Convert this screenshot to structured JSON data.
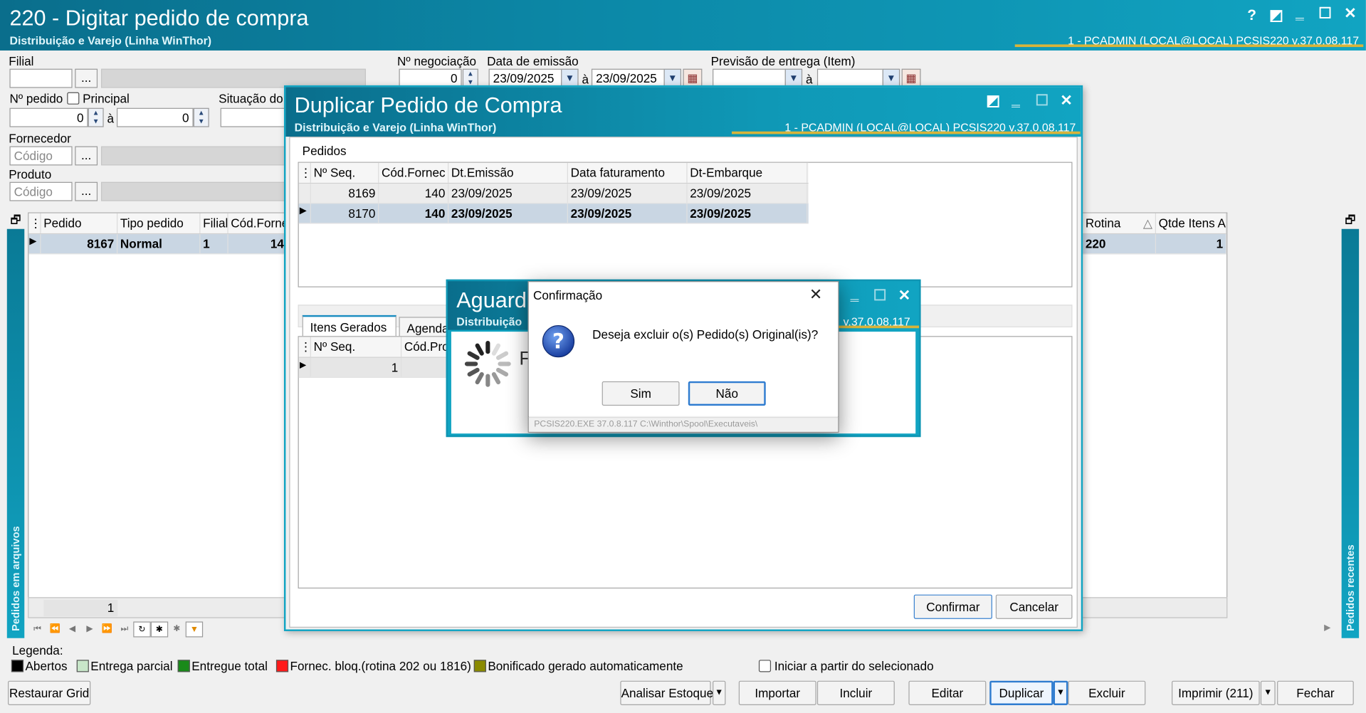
{
  "main": {
    "title": "220 - Digitar pedido de compra",
    "subtitle": "Distribuição e Varejo (Linha WinThor)",
    "user_info": "1 - PCADMIN (LOCAL@LOCAL)   PCSIS220  v.37.0.08.117",
    "winbtns": {
      "help": "?",
      "restore": "◩",
      "min": "‗",
      "max": "☐",
      "close": "✕"
    }
  },
  "filters": {
    "filial_label": "Filial",
    "dots": "...",
    "num_negociacao_label": "Nº negociação",
    "num_negociacao_value": "0",
    "data_emissao_label": "Data de emissão",
    "data_emissao_from": "23/09/2025",
    "data_emissao_to": "23/09/2025",
    "a_sep": "à",
    "previsao_label": "Previsão  de entrega (Item)",
    "num_pedido_label": "Nº pedido",
    "principal_label": "Principal",
    "num_pedido_from": "0",
    "num_pedido_to": "0",
    "situacao_label": "Situação do",
    "fornecedor_label": "Fornecedor",
    "produto_label": "Produto",
    "codigo_placeholder": "Código"
  },
  "main_grid": {
    "columns": [
      "Pedido",
      "Tipo pedido",
      "Filial",
      "Cód.Forne"
    ],
    "row": [
      "8167",
      "Normal",
      "1",
      "14"
    ],
    "right_columns": [
      "Rotina",
      "Qtde Itens A"
    ],
    "right_row": [
      "220",
      "1"
    ],
    "footer_count": "1"
  },
  "side_tabs": {
    "left": "Pedidos em arquivos",
    "right": "Pedidos recentes"
  },
  "legend": {
    "title": "Legenda:",
    "items": [
      {
        "label": "Abertos",
        "color": "#000000"
      },
      {
        "label": "Entrega parcial",
        "color": "#c8e6c9"
      },
      {
        "label": "Entregue total",
        "color": "#1a8a1a"
      },
      {
        "label": "Fornec. bloq.(rotina 202 ou 1816)",
        "color": "#ff1a1a"
      },
      {
        "label": "Bonificado gerado automaticamente",
        "color": "#8a8a00"
      }
    ],
    "iniciar_label": "Iniciar a partir do selecionado"
  },
  "bottom_buttons": {
    "restaurar": "Restaurar Grid",
    "analisar": "Analisar Estoque",
    "importar": "Importar",
    "incluir": "Incluir",
    "editar": "Editar",
    "duplicar": "Duplicar",
    "excluir": "Excluir",
    "imprimir": "Imprimir (211)",
    "fechar": "Fechar"
  },
  "dup_dialog": {
    "title": "Duplicar Pedido de Compra",
    "subtitle": "Distribuição e Varejo (Linha WinThor)",
    "user_info": "1 - PCADMIN (LOCAL@LOCAL)   PCSIS220  v.37.0.08.117",
    "group_label": "Pedidos",
    "columns": [
      "Nº Seq.",
      "Cód.Fornec",
      "Dt.Emissão",
      "Data faturamento",
      "Dt-Embarque"
    ],
    "rows": [
      [
        "8169",
        "140",
        "23/09/2025",
        "23/09/2025",
        "23/09/2025"
      ],
      [
        "8170",
        "140",
        "23/09/2025",
        "23/09/2025",
        "23/09/2025"
      ]
    ],
    "tabs": [
      "Itens Gerados",
      "Agendar"
    ],
    "items_columns": [
      "Nº Seq.",
      "Cód.Pro"
    ],
    "items_row": [
      "1"
    ],
    "confirmar": "Confirmar",
    "cancelar": "Cancelar"
  },
  "wait_dialog": {
    "title": "Aguard",
    "subtitle": "Distribuição",
    "version": "v.37.0.08.117",
    "partial_text": "F"
  },
  "confirm_dialog": {
    "title": "Confirmação",
    "message": "Deseja excluir o(s) Pedido(s) Original(is)?",
    "sim": "Sim",
    "nao": "Não",
    "status": "PCSIS220.EXE 37.0.8.117 C:\\Winthor\\Spool\\Executaveis\\"
  }
}
